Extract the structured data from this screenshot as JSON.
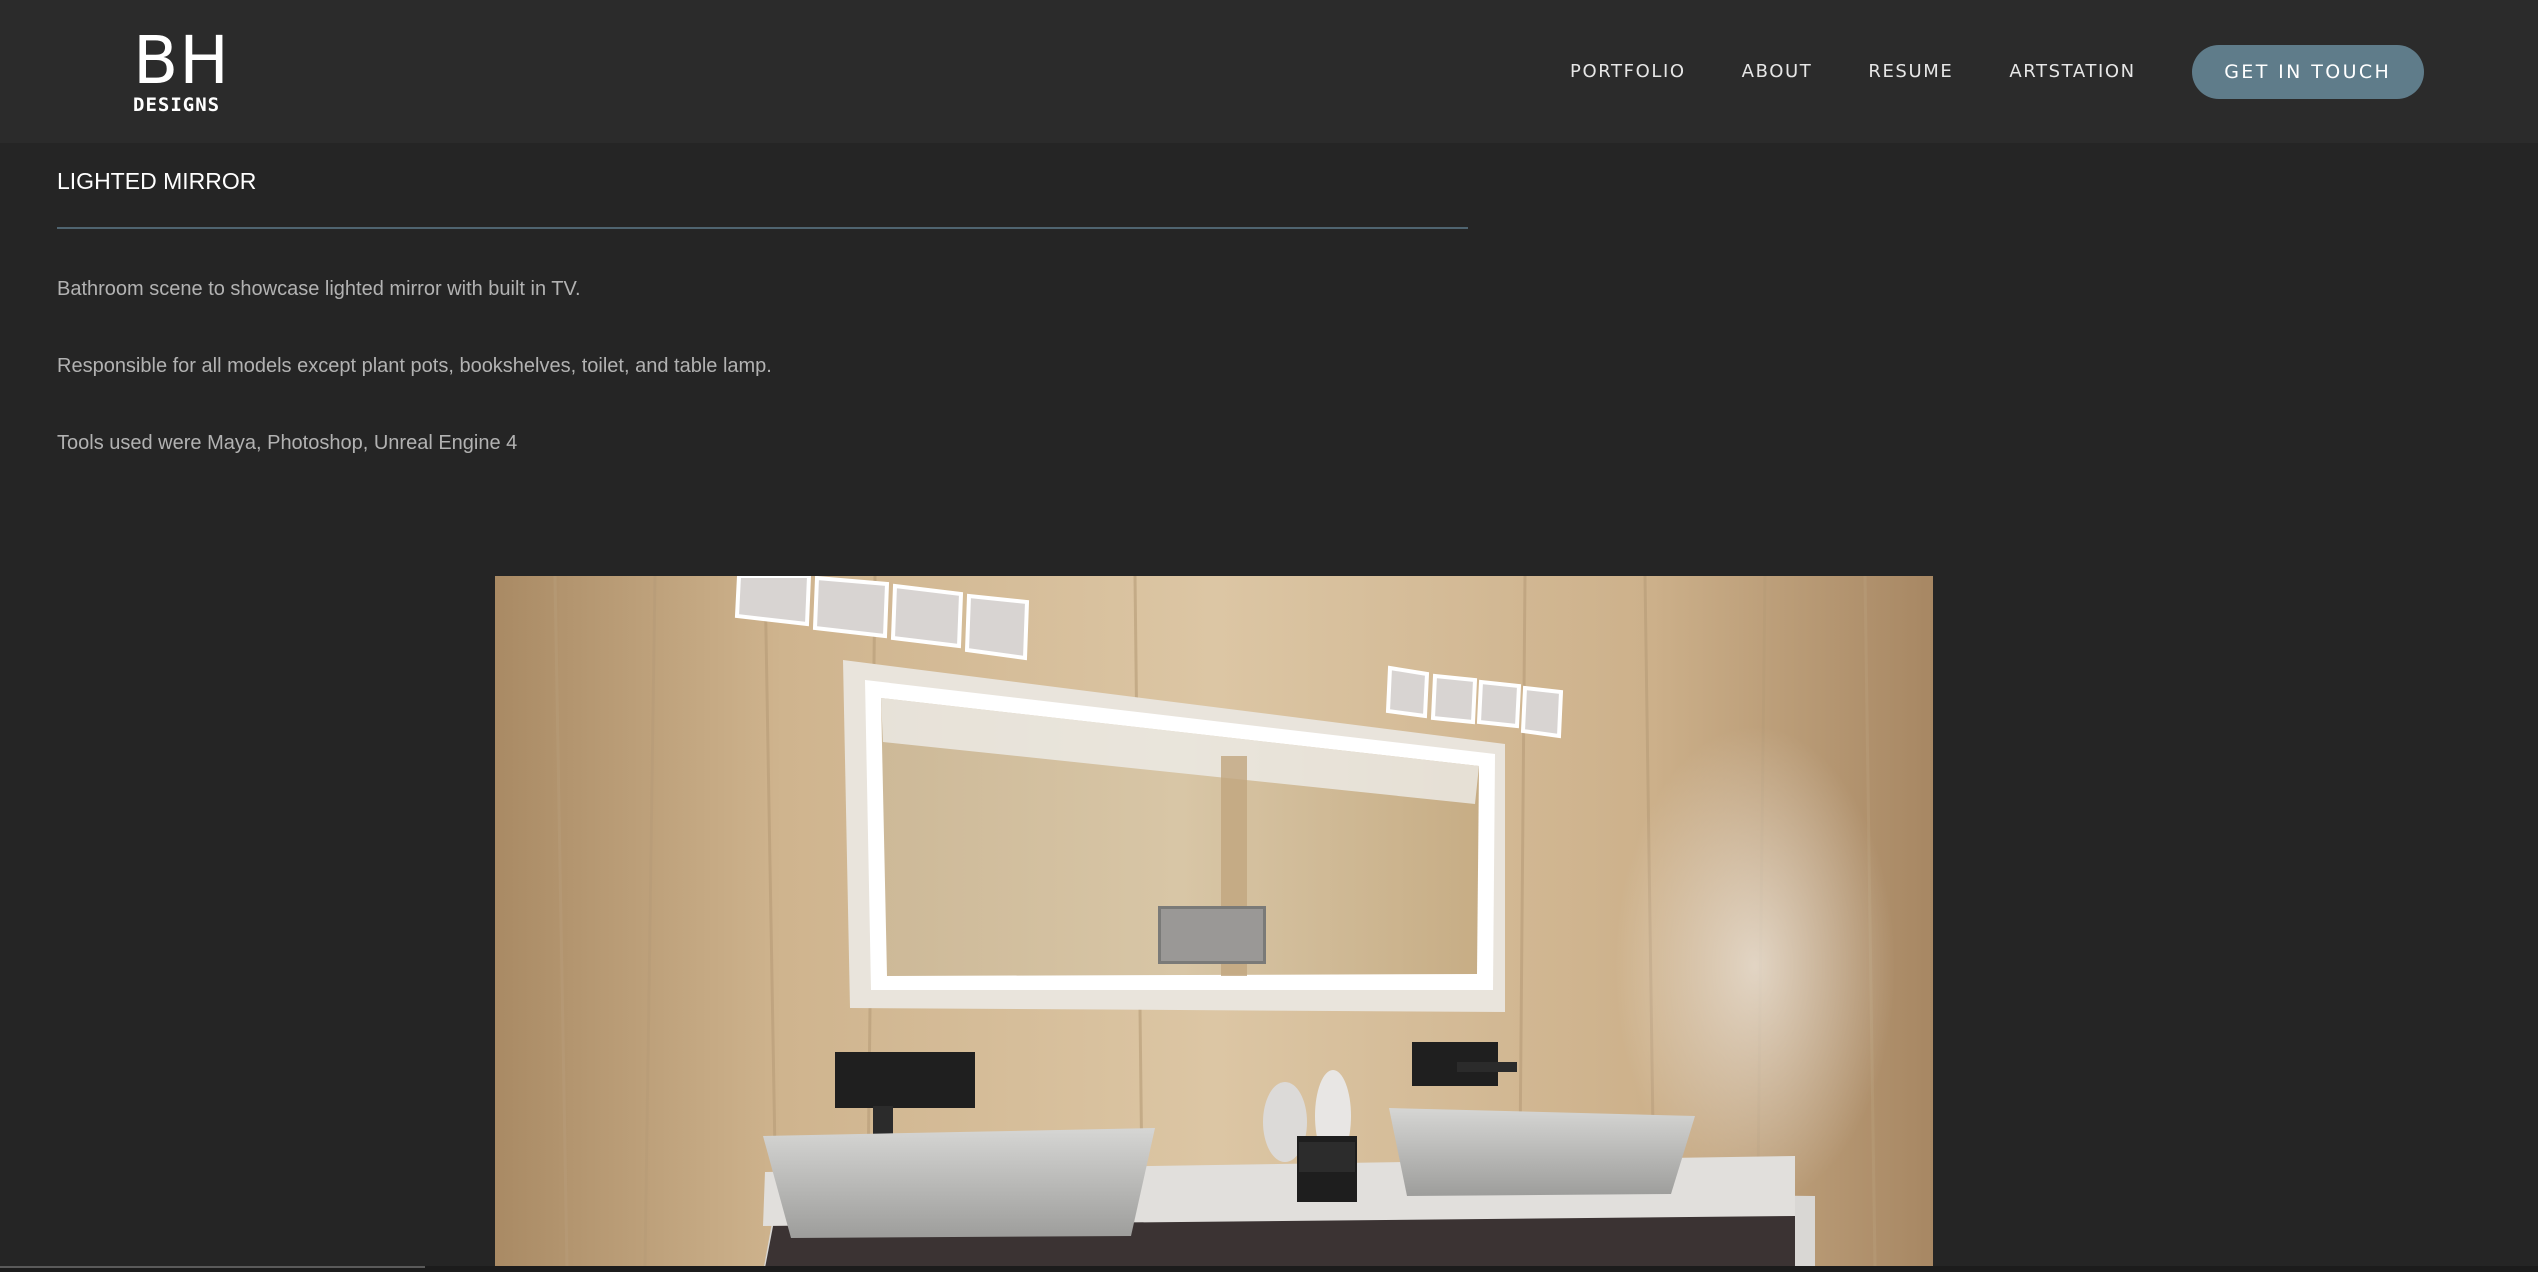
{
  "header": {
    "logo_main": "BH",
    "logo_sub": "DESIGNS",
    "nav": [
      {
        "label": "PORTFOLIO"
      },
      {
        "label": "ABOUT"
      },
      {
        "label": "RESUME"
      },
      {
        "label": "ARTSTATION"
      }
    ],
    "cta_label": "GET IN TOUCH"
  },
  "project": {
    "title": "LIGHTED MIRROR",
    "paragraphs": [
      "Bathroom scene to showcase lighted mirror with built in TV.",
      "Responsible for all models except plant pots, bookshelves, toilet, and table lamp.",
      "Tools used were Maya, Photoshop, Unreal Engine 4"
    ]
  },
  "colors": {
    "page_bg": "#252525",
    "header_bg": "#2b2b2b",
    "accent": "#5f7c8a",
    "divider": "#4f6470",
    "body_text": "#b2b2b2"
  }
}
